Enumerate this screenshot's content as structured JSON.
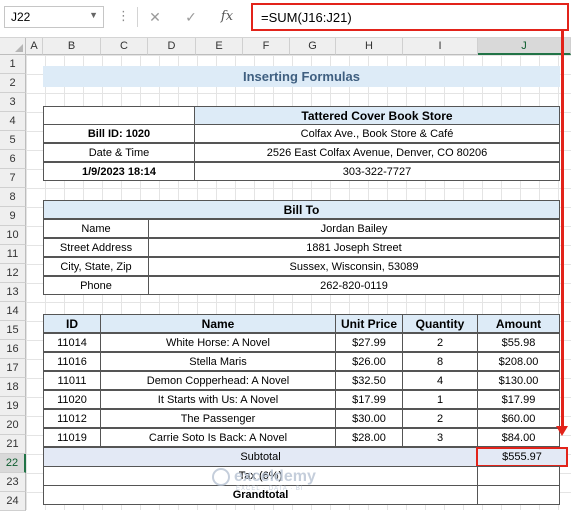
{
  "formula_bar": {
    "name_box": "J22",
    "cancel_icon": "✕",
    "enter_icon": "✓",
    "fx_icon": "fx",
    "formula": "=SUM(J16:J21)"
  },
  "columns": [
    "A",
    "B",
    "C",
    "D",
    "E",
    "F",
    "G",
    "H",
    "I",
    "J"
  ],
  "rows": [
    "1",
    "2",
    "3",
    "4",
    "5",
    "6",
    "7",
    "8",
    "9",
    "10",
    "11",
    "12",
    "13",
    "14",
    "15",
    "16",
    "17",
    "18",
    "19",
    "20",
    "21",
    "22",
    "23",
    "24"
  ],
  "selected": {
    "column": "J",
    "row": "22"
  },
  "title": "Inserting Formulas",
  "store": {
    "name": "Tattered Cover Book Store",
    "bill_id": "Bill ID: 1020",
    "address1": "Colfax Ave., Book Store & Café",
    "date_label": "Date & Time",
    "address2": "2526 East Colfax Avenue, Denver, CO 80206",
    "datetime": "1/9/2023 18:14",
    "phone": "303-322-7727"
  },
  "bill_to": {
    "header": "Bill To",
    "rows": [
      {
        "label": "Name",
        "value": "Jordan Bailey"
      },
      {
        "label": "Street Address",
        "value": "1881 Joseph Street"
      },
      {
        "label": "City, State, Zip",
        "value": "Sussex, Wisconsin, 53089"
      },
      {
        "label": "Phone",
        "value": "262-820-0119"
      }
    ]
  },
  "items": {
    "headers": {
      "id": "ID",
      "name": "Name",
      "unit_price": "Unit Price",
      "quantity": "Quantity",
      "amount": "Amount"
    },
    "rows": [
      {
        "id": "11014",
        "name": "White Horse: A Novel",
        "unit_price": "$27.99",
        "quantity": "2",
        "amount": "$55.98"
      },
      {
        "id": "11016",
        "name": "Stella Maris",
        "unit_price": "$26.00",
        "quantity": "8",
        "amount": "$208.00"
      },
      {
        "id": "11011",
        "name": "Demon Copperhead: A Novel",
        "unit_price": "$32.50",
        "quantity": "4",
        "amount": "$130.00"
      },
      {
        "id": "11020",
        "name": "It Starts with Us: A Novel",
        "unit_price": "$17.99",
        "quantity": "1",
        "amount": "$17.99"
      },
      {
        "id": "11012",
        "name": "The Passenger",
        "unit_price": "$30.00",
        "quantity": "2",
        "amount": "$60.00"
      },
      {
        "id": "11019",
        "name": "Carrie Soto Is Back: A Novel",
        "unit_price": "$28.00",
        "quantity": "3",
        "amount": "$84.00"
      }
    ]
  },
  "totals": {
    "subtotal_label": "Subtotal",
    "subtotal_value": "$555.97",
    "tax_label": "Tax (6%)",
    "grandtotal_label": "Grandtotal"
  },
  "watermark": {
    "name": "exceldemy",
    "tagline": "EXCEL · DATA · BI"
  },
  "colors": {
    "accent_red": "#e2231a",
    "header_blue": "#ddebf7",
    "excel_green": "#217346"
  }
}
